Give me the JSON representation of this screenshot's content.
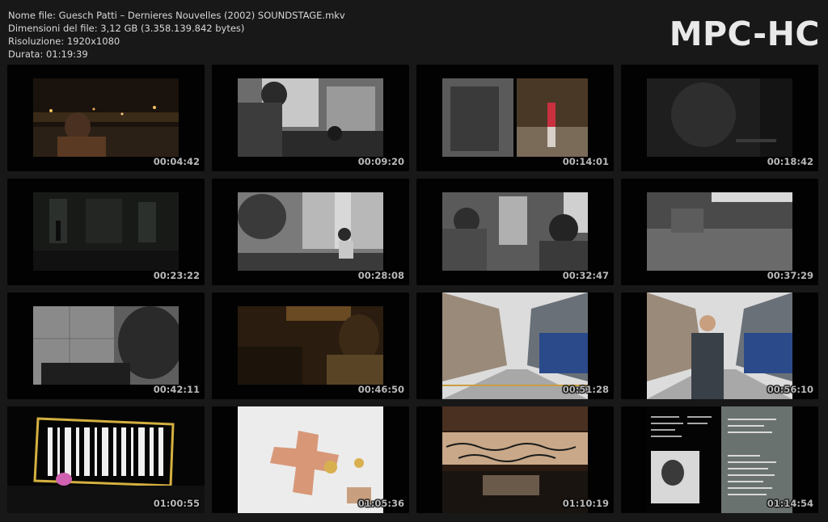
{
  "info": {
    "file_name": "Nome file: Guesch Patti – Dernieres Nouvelles (2002) SOUNDSTAGE.mkv",
    "file_size": "Dimensioni del file: 3,12 GB (3.358.139.842 bytes)",
    "resolution": "Risoluzione: 1920x1080",
    "duration": "Durata: 01:19:39"
  },
  "logo": "MPC-HC",
  "thumbnails": [
    {
      "time": "00:04:42",
      "scene": "night-street"
    },
    {
      "time": "00:09:20",
      "scene": "two-people-window"
    },
    {
      "time": "00:14:01",
      "scene": "split-dancer"
    },
    {
      "time": "00:18:42",
      "scene": "dark-close"
    },
    {
      "time": "00:23:22",
      "scene": "dark-hall"
    },
    {
      "time": "00:28:08",
      "scene": "woman-sofa"
    },
    {
      "time": "00:32:47",
      "scene": "two-faces"
    },
    {
      "time": "00:37:29",
      "scene": "blurred-gray"
    },
    {
      "time": "00:42:11",
      "scene": "man-floor"
    },
    {
      "time": "00:46:50",
      "scene": "amber-car"
    },
    {
      "time": "00:51:28",
      "scene": "street-day"
    },
    {
      "time": "00:56:10",
      "scene": "man-street"
    },
    {
      "time": "01:00:55",
      "scene": "barcode-stage"
    },
    {
      "time": "01:05:36",
      "scene": "red-cross"
    },
    {
      "time": "01:10:19",
      "scene": "banner-text"
    },
    {
      "time": "01:14:54",
      "scene": "credits"
    }
  ]
}
